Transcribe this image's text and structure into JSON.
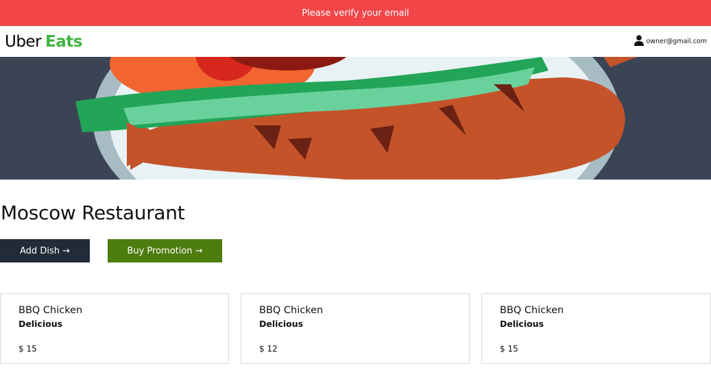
{
  "banner": {
    "text": "Please verify your email",
    "color": "#f24548"
  },
  "header": {
    "logo_part1": "Uber",
    "logo_part2": "Eats",
    "user_email": "owner@gmail.com",
    "user_icon": "user-icon"
  },
  "restaurant": {
    "name": "Moscow Restaurant",
    "add_dish_label": "Add Dish →",
    "buy_promotion_label": "Buy Promotion →"
  },
  "dishes": [
    {
      "name": "BBQ Chicken",
      "description": "Delicious",
      "price": "$ 15"
    },
    {
      "name": "BBQ Chicken",
      "description": "Delicious",
      "price": "$ 12"
    },
    {
      "name": "BBQ Chicken",
      "description": "Delicious",
      "price": "$ 15"
    }
  ],
  "colors": {
    "accent_green": "#3fb33f",
    "promo_button": "#4d7c0f",
    "dark_button": "#222b38"
  }
}
